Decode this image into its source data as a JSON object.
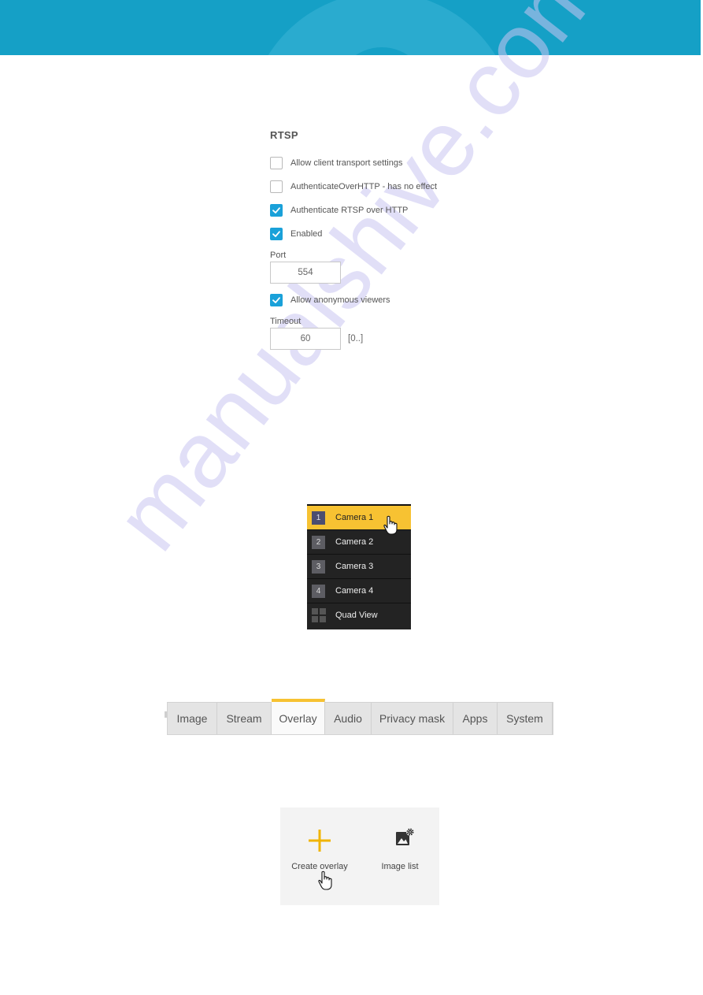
{
  "header": {
    "brand_color": "#15a0c6"
  },
  "watermark": "manualshive.com",
  "rtsp": {
    "title": "RTSP",
    "checkboxes": [
      {
        "label": "Allow client transport settings",
        "checked": false
      },
      {
        "label": "AuthenticateOverHTTP - has no effect",
        "checked": false
      },
      {
        "label": "Authenticate RTSP over HTTP",
        "checked": true
      },
      {
        "label": "Enabled",
        "checked": true
      }
    ],
    "port": {
      "label": "Port",
      "value": "554"
    },
    "anonymous": {
      "label": "Allow anonymous viewers",
      "checked": true
    },
    "timeout": {
      "label": "Timeout",
      "value": "60",
      "range": "[0..]"
    },
    "accent": "#1aa1d9"
  },
  "camera_menu": {
    "items": [
      {
        "num": "1",
        "label": "Camera 1",
        "active": true
      },
      {
        "num": "2",
        "label": "Camera 2",
        "active": false
      },
      {
        "num": "3",
        "label": "Camera 3",
        "active": false
      },
      {
        "num": "4",
        "label": "Camera 4",
        "active": false
      }
    ],
    "quad_label": "Quad View",
    "highlight": "#f7c232"
  },
  "tabs": {
    "items": [
      {
        "label": "Image",
        "active": false
      },
      {
        "label": "Stream",
        "active": false
      },
      {
        "label": "Overlay",
        "active": true
      },
      {
        "label": "Audio",
        "active": false
      },
      {
        "label": "Privacy mask",
        "active": false
      },
      {
        "label": "Apps",
        "active": false
      },
      {
        "label": "System",
        "active": false
      }
    ]
  },
  "overlay_panel": {
    "create_label": "Create overlay",
    "image_list_label": "Image list",
    "accent": "#f0b400"
  }
}
